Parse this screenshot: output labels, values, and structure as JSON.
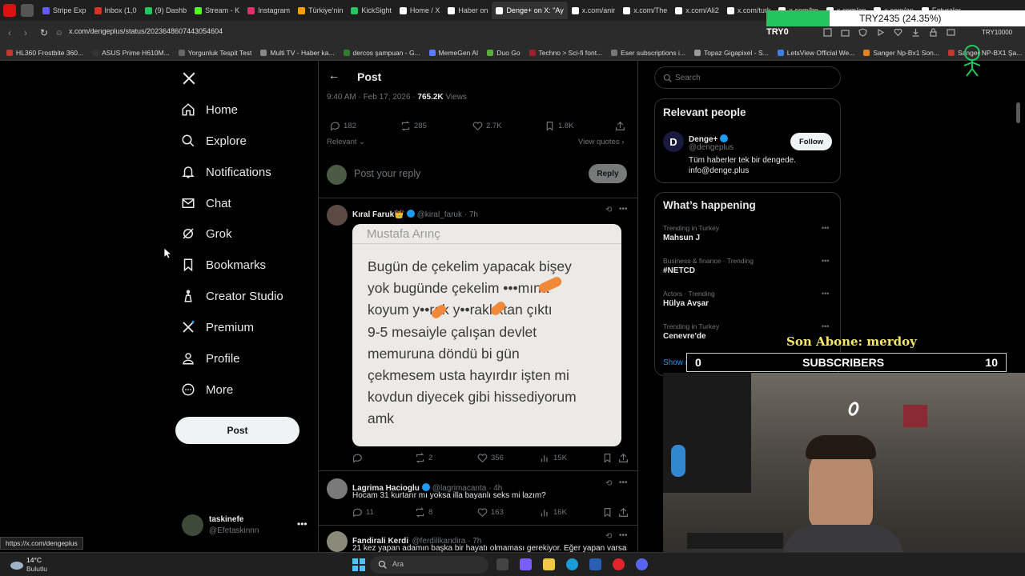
{
  "browser": {
    "tabs": [
      {
        "label": "Stripe Exp",
        "color": "#635bff"
      },
      {
        "label": "Inbox (1,0",
        "color": "#d93025"
      },
      {
        "label": "(9) Dashb",
        "color": "#22c55e"
      },
      {
        "label": "Stream - K",
        "color": "#53fc18"
      },
      {
        "label": "Instagram",
        "color": "#e1306c"
      },
      {
        "label": "Türkiye'nin",
        "color": "#f59e0b"
      },
      {
        "label": "KickSight",
        "color": "#22c55e"
      },
      {
        "label": "Home / X",
        "color": "#ffffff"
      },
      {
        "label": "Haber on",
        "color": "#ffffff"
      },
      {
        "label": "Denge+ on X: \"Ay",
        "color": "#ffffff"
      },
      {
        "label": "x.com/anir",
        "color": "#ffffff"
      },
      {
        "label": "x.com/The",
        "color": "#ffffff"
      },
      {
        "label": "x.com/Ali2",
        "color": "#ffffff"
      },
      {
        "label": "x.com/turk",
        "color": "#ffffff"
      },
      {
        "label": "x.com/bp",
        "color": "#ffffff"
      },
      {
        "label": "x.com/an",
        "color": "#ffffff"
      },
      {
        "label": "x.com/an",
        "color": "#ffffff"
      },
      {
        "label": "Faturalar",
        "color": "#ffffff"
      }
    ],
    "active_tab_index": 9,
    "url": "x.com/dengeplus/status/2023648607443054604",
    "bookmarks": [
      "HL360 Frostbite 360...",
      "ASUS Prime H610M...",
      "Yorgunluk Tespit Test",
      "Multi TV - Haber ka...",
      "dercos şampuan - G...",
      "MemeGen AI",
      "Duo Go",
      "Techno > Sci-fi font...",
      "Eser subscriptions i...",
      "Topaz Gigapixel - S...",
      "LetsView Official We...",
      "Sanger Np-Bx1 Son...",
      "Sanger NP-BX1 Şa..."
    ],
    "status_url": "https://x.com/dengeplus"
  },
  "currency": {
    "label": "TRY2435 (24.35%)",
    "fill_percent": 24.35,
    "left_label": "TRY0",
    "right_label": "TRY10000"
  },
  "nav": {
    "items": [
      "Home",
      "Explore",
      "Notifications",
      "Chat",
      "Grok",
      "Bookmarks",
      "Creator Studio",
      "Premium",
      "Profile",
      "More"
    ],
    "post_button": "Post",
    "account_name": "taskinefe",
    "account_handle": "@Efetaskinnn"
  },
  "post": {
    "header_title": "Post",
    "timestamp": "9:40 AM · Feb 17, 2026 ·",
    "views_count": "765.2K",
    "views_label": "Views",
    "replies": "182",
    "reposts": "285",
    "likes": "2.7K",
    "bookmarks": "1.8K",
    "sort_label": "Relevant",
    "view_quotes": "View quotes",
    "reply_placeholder": "Post your reply",
    "reply_button": "Reply"
  },
  "replies": [
    {
      "name": "Kıral Faruk👑",
      "handle": "@kiral_faruk · 7h",
      "image_text_header": "Mustafa Arınç",
      "image_text": "Bugün de çekelim yapacak bişey yok bugünde çekelim •••mına koyum y••rak y••raklıktan çıktı 9-5 mesaiyle çalışan devlet memuruna döndü bi gün çekmesem usta hayırdır işten mi kovdun diyecek gibi hissediyorum amk",
      "image_lines": [
        "Bugün de çekelim yapacak bişey",
        "yok bugünde çekelim •••mına",
        "koyum y••rak y••raklıktan çıktı",
        "9-5 mesaiyle çalışan devlet",
        "memuruna döndü bi gün",
        "çekmesem usta hayırdır işten mi",
        "kovdun diyecek gibi hissediyorum",
        "amk"
      ],
      "reposts": "2",
      "likes": "356",
      "views": "15K"
    },
    {
      "name": "Lagrima Hacioglu",
      "handle": "@lagrimacanta · 4h",
      "text": "Hocam 31 kurtarır mı yoksa illa bayanlı seks mi lazım?",
      "replies": "11",
      "reposts": "8",
      "likes": "163",
      "views": "16K"
    },
    {
      "name": "Fandirali Kerdi",
      "handle": "@ferdilikandira · 7h",
      "text": "21 kez yapan adamın başka bir hayatı olmaması gerekiyor. Eğer yapan varsa"
    }
  ],
  "right": {
    "search_placeholder": "Search",
    "relevant_title": "Relevant people",
    "person_name": "Denge+",
    "person_handle": "@dengeplus",
    "person_bio": "Tüm haberler tek bir dengede. info@denge.plus",
    "follow_label": "Follow",
    "happening_title": "What’s happening",
    "trends": [
      {
        "meta": "Trending in Turkey",
        "name": "Mahsun J"
      },
      {
        "meta": "Business & finance · Trending",
        "name": "#NETCD"
      },
      {
        "meta": "Actors · Trending",
        "name": "Hülya Avşar"
      },
      {
        "meta": "Trending in Turkey",
        "name": "Cenevre'de"
      }
    ],
    "show_more": "Show more"
  },
  "overlay": {
    "son_abone": "Son Abone: merdoy",
    "subs_left": "0",
    "subs_label": "SUBSCRIBERS",
    "subs_right": "10"
  },
  "taskbar": {
    "weather_temp": "14°C",
    "weather_text": "Bulutlu",
    "search_placeholder": "Ara"
  }
}
